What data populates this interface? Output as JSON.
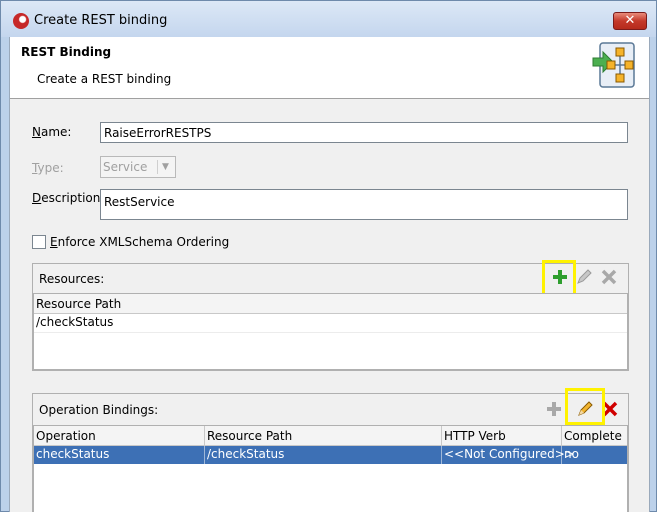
{
  "window": {
    "title": "Create REST binding",
    "close_glyph": "✕"
  },
  "header": {
    "title": "REST Binding",
    "subtitle": "Create a REST binding"
  },
  "form": {
    "name_label_u": "N",
    "name_label_rest": "ame:",
    "name_value": "RaiseErrorRESTPS",
    "type_label_u": "T",
    "type_label_rest": "ype:",
    "type_value": "Service",
    "description_label_u": "D",
    "description_label_rest": "escription:",
    "description_value": "RestService",
    "enforce_label_u": "E",
    "enforce_label_rest": "nforce XMLSchema Ordering",
    "enforce_checked": false
  },
  "resources": {
    "label_u": "R",
    "label_rest": "esources:",
    "columns": [
      "Resource Path"
    ],
    "rows": [
      [
        "/checkStatus"
      ]
    ]
  },
  "operations": {
    "label": "Operation Bindings:",
    "columns": [
      "Operation",
      "Resource Path",
      "HTTP Verb",
      "Complete"
    ],
    "rows": [
      [
        "checkStatus",
        "/checkStatus",
        "<<Not Configured>>",
        "no"
      ]
    ]
  },
  "icons": {
    "add": "plus-icon",
    "edit": "pencil-icon",
    "delete": "delete-icon"
  },
  "colors": {
    "highlight": "#fff200",
    "selection": "#3d70b5",
    "add_green": "#2e9e2e",
    "delete_red": "#d00000"
  }
}
